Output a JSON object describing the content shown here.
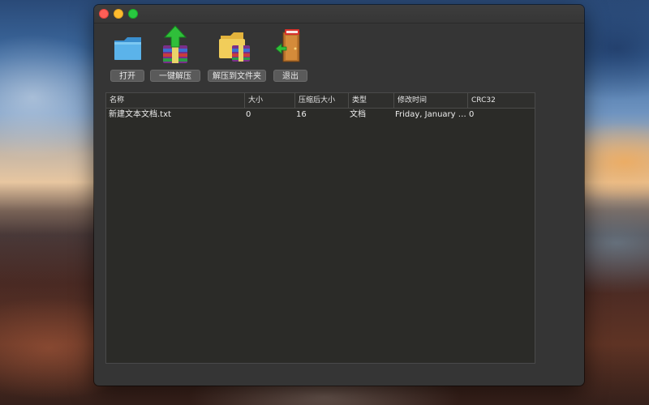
{
  "toolbar": {
    "open_label": "打开",
    "extract_label": "一键解压",
    "extract_to_folder_label": "解压到文件夹",
    "quit_label": "退出"
  },
  "table": {
    "columns": [
      "名称",
      "大小",
      "压缩后大小",
      "类型",
      "修改时间",
      "CRC32"
    ],
    "rows": [
      [
        "新建文本文档.txt",
        "0",
        "16",
        "文档",
        "Friday, January 1...",
        "0"
      ]
    ]
  },
  "colors": {
    "window_bg": "#353535",
    "table_bg": "#2b2b28",
    "text": "#ececec",
    "close": "#fe5f57",
    "minimize": "#febc2e",
    "zoom": "#28c840"
  }
}
